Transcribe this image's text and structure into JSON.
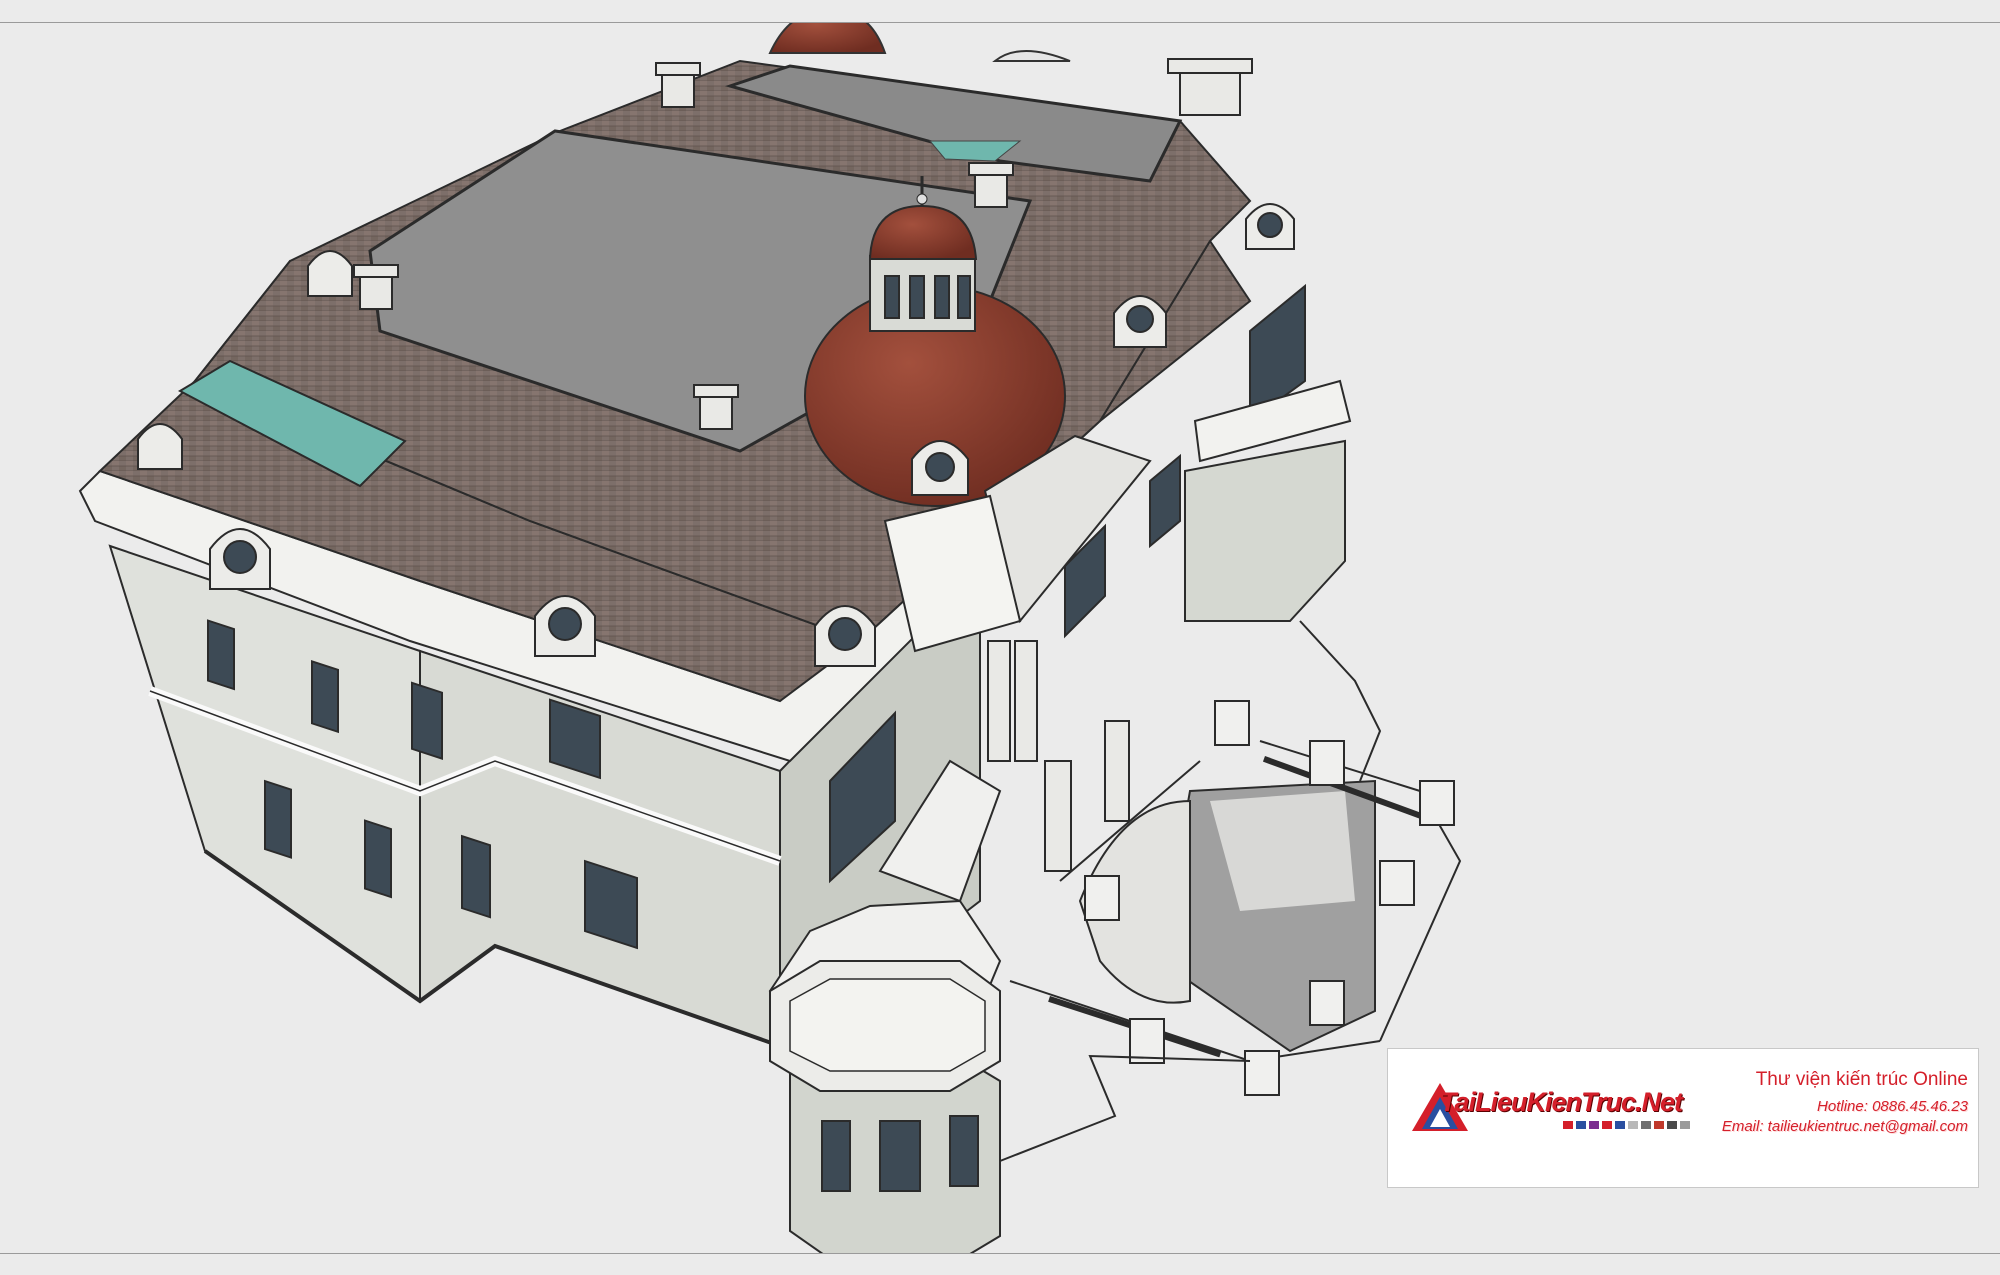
{
  "model": {
    "description_name": "french-chateau-3d-model",
    "colors": {
      "background": "#ebebeb",
      "wall": "#dfe1dc",
      "wall_shadow": "#c7cac4",
      "trim": "#f2f2ef",
      "roof_shingle": "#7d6f6a",
      "flat_roof": "#8f8f8f",
      "dome": "#8a3a2b",
      "glass": "#6fb7ad",
      "window": "#3d4a55"
    }
  },
  "watermark": {
    "logo_text": "TaiLieuKienTruc.Net",
    "title": "Thư viện kiến trúc Online",
    "hotline": "Hotline: 0886.45.46.23",
    "email": "Email: tailieukientruc.net@gmail.com",
    "swatch_colors": [
      "#d41f2a",
      "#2a4fa0",
      "#7a2c8f",
      "#d41f2a",
      "#2a4fa0",
      "#b8b8b8",
      "#6f6f6f",
      "#c0392b",
      "#4a4a4a",
      "#9a9a9a"
    ]
  }
}
